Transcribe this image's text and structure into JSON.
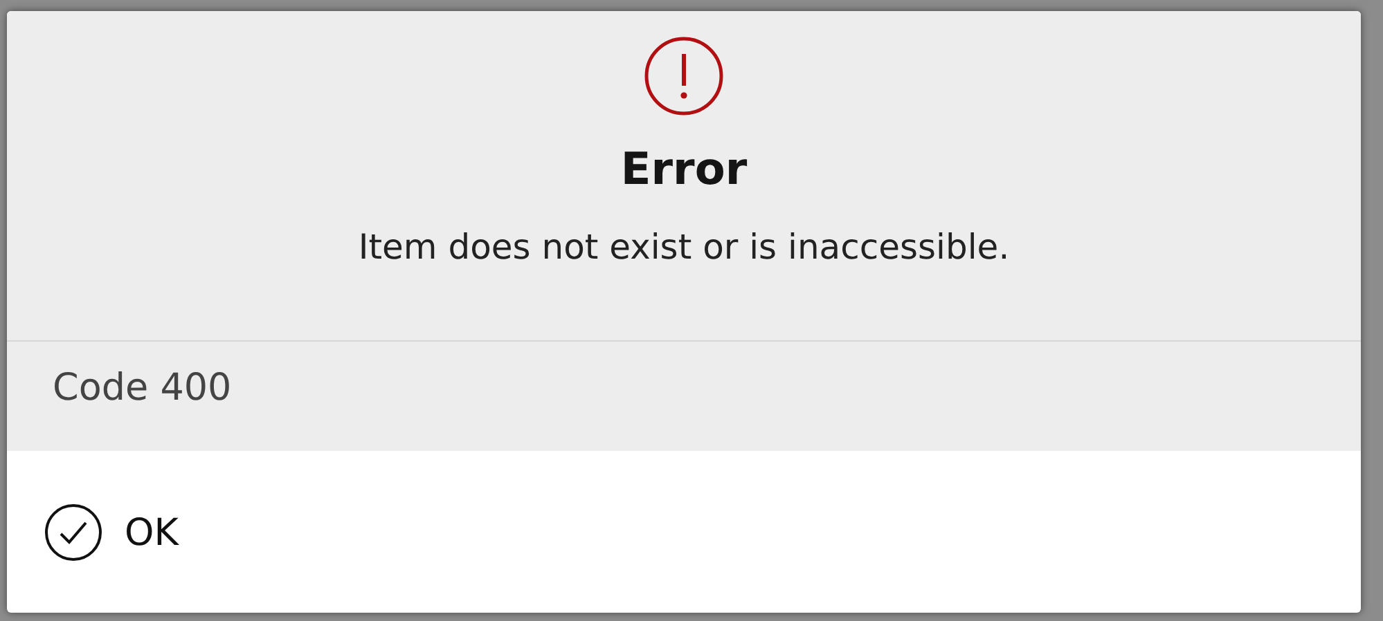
{
  "dialog": {
    "title": "Error",
    "message": "Item does not exist or is inaccessible.",
    "details": "Code 400",
    "buttons": [
      {
        "label": "OK"
      }
    ]
  }
}
